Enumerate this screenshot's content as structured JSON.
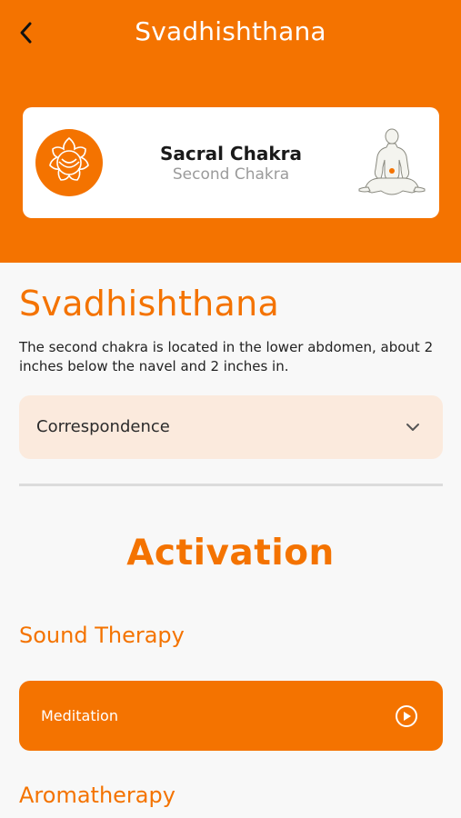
{
  "nav": {
    "title": "Svadhishthana",
    "back_icon": "chevron-left-icon"
  },
  "card": {
    "title": "Sacral Chakra",
    "subtitle": "Second Chakra",
    "symbol_icon": "sacral-chakra-symbol-icon",
    "figure_icon": "meditating-figure-icon"
  },
  "content": {
    "section_title": "Svadhishthana",
    "description": "The second chakra is located in the lower abdomen, about 2 inches below the navel and 2 inches in.",
    "accordion": {
      "label": "Correspondence",
      "icon": "chevron-down-icon"
    },
    "activation_title": "Activation",
    "sound_therapy": {
      "title": "Sound Therapy",
      "button_label": "Meditation",
      "button_icon": "play-circle-icon"
    },
    "aromatherapy_title": "Aromatherapy"
  },
  "colors": {
    "accent": "#f47300",
    "accordion_bg": "#fbeadd",
    "background": "#f8f8f8"
  }
}
